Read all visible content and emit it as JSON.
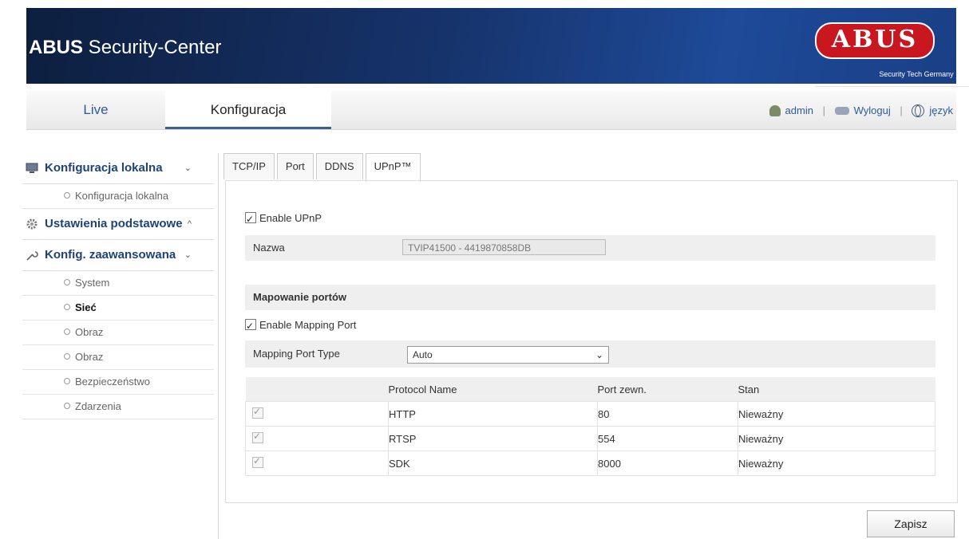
{
  "header": {
    "title_bold": "ABUS",
    "title_rest": " Security-Center",
    "logo_word": "ABUS",
    "logo_sub": "Security Tech Germany"
  },
  "nav": {
    "live": "Live",
    "konfiguracja": "Konfiguracja"
  },
  "user": {
    "name": "admin",
    "logout": "Wyloguj",
    "language": "język"
  },
  "sidebar": {
    "local_section": "Konfiguracja lokalna",
    "local_item": "Konfiguracja lokalna",
    "basic_section": "Ustawienia podstawowe",
    "advanced_section": "Konfig. zaawansowana",
    "items": [
      "System",
      "Sieć",
      "Obraz",
      "Obraz",
      "Bezpieczeństwo",
      "Zdarzenia"
    ]
  },
  "tabs": [
    "TCP/IP",
    "Port",
    "DDNS",
    "UPnP™"
  ],
  "upnp": {
    "enable_label": "Enable UPnP",
    "name_label": "Nazwa",
    "name_value": "TVIP41500 - 4419870858DB",
    "mapping_header": "Mapowanie portów",
    "enable_mapping_label": "Enable Mapping Port",
    "mapping_type_label": "Mapping Port Type",
    "mapping_type_value": "Auto"
  },
  "table": {
    "headers": [
      "Protocol Name",
      "Port zewn.",
      "Stan"
    ],
    "rows": [
      {
        "protocol": "HTTP",
        "port": "80",
        "status": "Nieważny"
      },
      {
        "protocol": "RTSP",
        "port": "554",
        "status": "Nieważny"
      },
      {
        "protocol": "SDK",
        "port": "8000",
        "status": "Nieważny"
      }
    ]
  },
  "save_label": "Zapisz"
}
